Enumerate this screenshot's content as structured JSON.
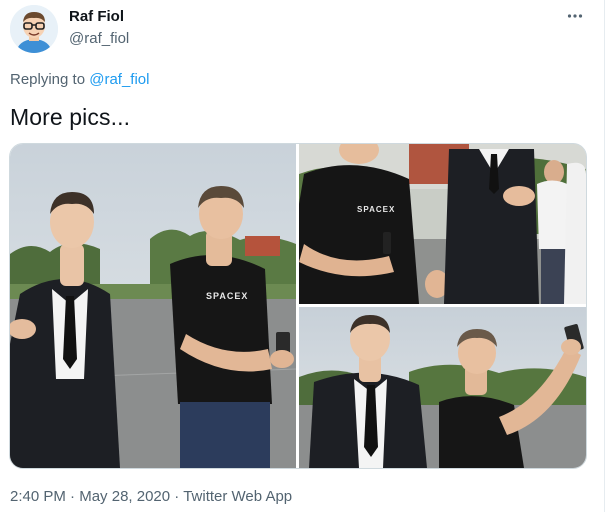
{
  "author": {
    "display_name": "Raf Fiol",
    "handle": "@raf_fiol",
    "avatar_icon": "cartoon-avatar-with-glasses"
  },
  "more_icon": "more-horizontal-icon",
  "reply": {
    "prefix": "Replying to ",
    "mention": "@raf_fiol"
  },
  "tweet": {
    "text": "More pics...",
    "photos": [
      {
        "alt": "photo-1",
        "shirt_text": "SPACEX"
      },
      {
        "alt": "photo-2",
        "shirt_text": "SPACEX"
      },
      {
        "alt": "photo-3"
      }
    ]
  },
  "meta": {
    "time": "2:40 PM",
    "separator1": " · ",
    "date": "May 28, 2020",
    "separator2": " · ",
    "source": "Twitter Web App"
  },
  "colors": {
    "link": "#1d9bf0",
    "secondary_text": "#536471",
    "primary_text": "#0f1419",
    "border": "#cfd9de"
  }
}
